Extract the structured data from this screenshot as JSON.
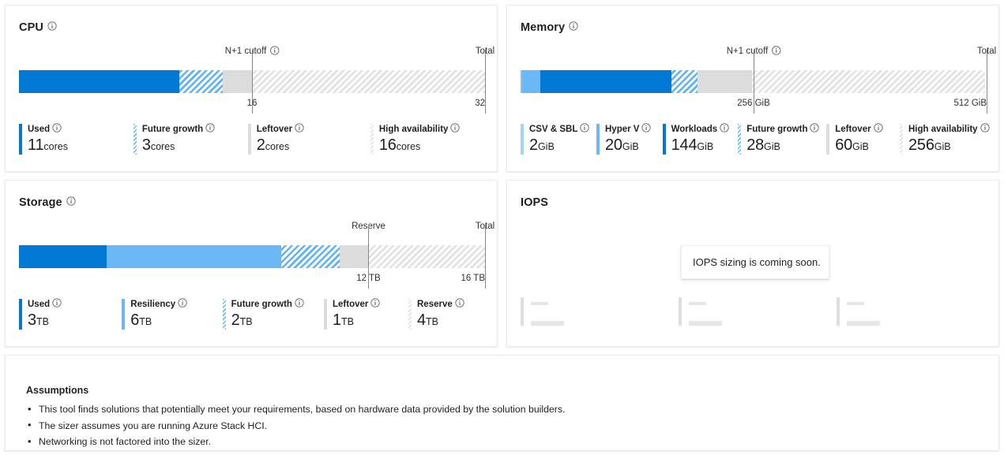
{
  "cards": {
    "cpu": {
      "title": "CPU",
      "has_info": true,
      "markers": [
        {
          "label": "N+1 cutoff",
          "has_info": true,
          "value": "16",
          "pct": 50.0
        },
        {
          "label": "Total",
          "has_info": false,
          "value": "32",
          "pct": 100.0
        }
      ],
      "unit": "cores",
      "total": 32,
      "segments": [
        {
          "name": "Used",
          "value": 11,
          "unit": "cores",
          "style": "solid-blue",
          "has_info": true
        },
        {
          "name": "Future growth",
          "value": 3,
          "unit": "cores",
          "style": "hatch-blue",
          "has_info": true
        },
        {
          "name": "Leftover",
          "value": 2,
          "unit": "cores",
          "style": "gray",
          "has_info": true
        },
        {
          "name": "High availability",
          "value": 16,
          "unit": "cores",
          "style": "hatch-gray",
          "has_info": true
        }
      ],
      "legend_widths": [
        168,
        168,
        180,
        180
      ]
    },
    "memory": {
      "title": "Memory",
      "has_info": true,
      "markers": [
        {
          "label": "N+1 cutoff",
          "has_info": true,
          "value": "256 GiB",
          "pct": 50.0
        },
        {
          "label": "Total",
          "has_info": false,
          "value": "512 GiB",
          "pct": 100.0
        }
      ],
      "unit": "GiB",
      "total": 512,
      "segments": [
        {
          "name": "CSV & SBL",
          "value": 2,
          "unit": "GiB",
          "style": "lighter-blue",
          "has_info": true
        },
        {
          "name": "Hyper V",
          "value": 20,
          "unit": "GiB",
          "style": "light-blue",
          "has_info": true
        },
        {
          "name": "Workloads",
          "value": 144,
          "unit": "GiB",
          "style": "solid-blue",
          "has_info": true
        },
        {
          "name": "Future growth",
          "value": 28,
          "unit": "GiB",
          "style": "hatch-blue",
          "has_info": true
        },
        {
          "name": "Leftover",
          "value": 60,
          "unit": "GiB",
          "style": "gray",
          "has_info": true
        },
        {
          "name": "High availability",
          "value": 256,
          "unit": "GiB",
          "style": "hatch-gray",
          "has_info": true
        }
      ],
      "legend_widths": [
        96,
        90,
        103,
        112,
        100,
        120
      ]
    },
    "storage": {
      "title": "Storage",
      "has_info": true,
      "markers": [
        {
          "label": "Reserve",
          "has_info": false,
          "value": "12 TB",
          "pct": 75.0
        },
        {
          "label": "Total",
          "has_info": false,
          "value": "16 TB",
          "pct": 100.0
        }
      ],
      "unit": "TB",
      "total": 16,
      "segments": [
        {
          "name": "Used",
          "value": 3,
          "unit": "TB",
          "style": "solid-blue",
          "has_info": true
        },
        {
          "name": "Resiliency",
          "value": 6,
          "unit": "TB",
          "style": "light-blue",
          "has_info": true
        },
        {
          "name": "Future growth",
          "value": 2,
          "unit": "TB",
          "style": "hatch-blue",
          "has_info": true
        },
        {
          "name": "Leftover",
          "value": 1,
          "unit": "TB",
          "style": "gray",
          "has_info": true
        },
        {
          "name": "Reserve",
          "value": 4,
          "unit": "TB",
          "style": "hatch-gray",
          "has_info": true
        }
      ],
      "legend_widths": [
        134,
        131,
        132,
        110,
        110
      ]
    },
    "iops": {
      "title": "IOPS",
      "has_info": false,
      "message": "IOPS sizing is coming soon.",
      "placeholder_count": 3
    },
    "assumptions": {
      "title": "Assumptions",
      "items": [
        "This tool finds solutions that potentially meet your requirements, based on hardware data provided by the solution builders.",
        "The sizer assumes you are running Azure Stack HCI.",
        "Networking is not factored into the sizer."
      ]
    }
  },
  "chart_data": [
    {
      "type": "bar",
      "title": "CPU",
      "orientation": "horizontal-stacked",
      "unit": "cores",
      "total": 32,
      "categories": [
        "Used",
        "Future growth",
        "Leftover",
        "High availability"
      ],
      "values": [
        11,
        3,
        2,
        16
      ],
      "axis_ticks": [
        {
          "label": "16",
          "value": 16
        },
        {
          "label": "32",
          "value": 32
        }
      ],
      "annotations": [
        {
          "label": "N+1 cutoff",
          "value": 16
        },
        {
          "label": "Total",
          "value": 32
        }
      ],
      "legend_position": "bottom",
      "grid": false
    },
    {
      "type": "bar",
      "title": "Memory",
      "orientation": "horizontal-stacked",
      "unit": "GiB",
      "total": 512,
      "categories": [
        "CSV & SBL",
        "Hyper V",
        "Workloads",
        "Future growth",
        "Leftover",
        "High availability"
      ],
      "values": [
        2,
        20,
        144,
        28,
        60,
        256
      ],
      "axis_ticks": [
        {
          "label": "256 GiB",
          "value": 256
        },
        {
          "label": "512 GiB",
          "value": 512
        }
      ],
      "annotations": [
        {
          "label": "N+1 cutoff",
          "value": 256
        },
        {
          "label": "Total",
          "value": 512
        }
      ],
      "legend_position": "bottom",
      "grid": false
    },
    {
      "type": "bar",
      "title": "Storage",
      "orientation": "horizontal-stacked",
      "unit": "TB",
      "total": 16,
      "categories": [
        "Used",
        "Resiliency",
        "Future growth",
        "Leftover",
        "Reserve"
      ],
      "values": [
        3,
        6,
        2,
        1,
        4
      ],
      "axis_ticks": [
        {
          "label": "12 TB",
          "value": 12
        },
        {
          "label": "16 TB",
          "value": 16
        }
      ],
      "annotations": [
        {
          "label": "Reserve",
          "value": 12
        },
        {
          "label": "Total",
          "value": 16
        }
      ],
      "legend_position": "bottom",
      "grid": false
    },
    {
      "type": "bar",
      "title": "IOPS",
      "orientation": "horizontal-stacked",
      "unit": "",
      "total": null,
      "categories": [],
      "values": [],
      "note": "IOPS sizing is coming soon.",
      "legend_position": "bottom",
      "grid": false
    }
  ],
  "colors": {
    "solid_blue": "#0078d4",
    "light_blue": "#6cb8f6",
    "lighter_blue": "#a5d4fa",
    "gray": "#dcdcdc",
    "hatch_blue": "#5cb3f5",
    "hatch_gray": "#e2e2e2",
    "card_border": "#ebebeb",
    "text": "#201f1e"
  }
}
